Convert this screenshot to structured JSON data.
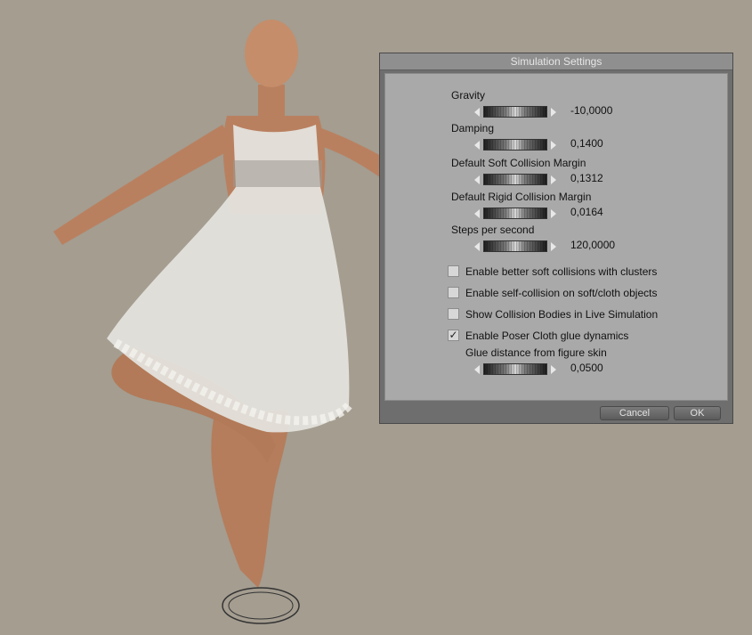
{
  "dialog": {
    "title": "Simulation Settings",
    "cancel_label": "Cancel",
    "ok_label": "OK"
  },
  "params": [
    {
      "label": "Gravity",
      "value": "-10,0000"
    },
    {
      "label": "Damping",
      "value": "0,1400"
    },
    {
      "label": "Default Soft Collision Margin",
      "value": "0,1312"
    },
    {
      "label": "Default Rigid Collision Margin",
      "value": "0,0164"
    },
    {
      "label": "Steps per second",
      "value": "120,0000"
    }
  ],
  "checkboxes": [
    {
      "label": "Enable better soft collisions with clusters",
      "checked": false
    },
    {
      "label": "Enable self-collision on soft/cloth objects",
      "checked": false
    },
    {
      "label": "Show Collision Bodies in Live Simulation",
      "checked": false
    },
    {
      "label": "Enable Poser Cloth glue dynamics",
      "checked": true,
      "mark": "✓"
    }
  ],
  "glue": {
    "label": "Glue distance from figure skin",
    "value": "0,0500"
  },
  "colors": {
    "viewport_bg": "#a49d90",
    "dialog_bg": "#6e6e6e",
    "panel_bg": "#a9a9a9"
  }
}
